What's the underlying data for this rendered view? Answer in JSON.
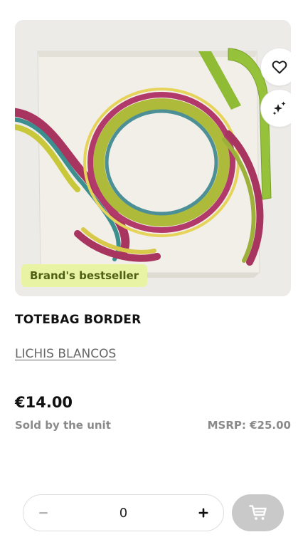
{
  "product": {
    "image_alt": "Totebag border product photo",
    "badge": "Brand's bestseller",
    "title": "TOTEBAG BORDER",
    "brand": "LICHIS BLANCOS",
    "price": "€14.00",
    "unit_text": "Sold by the unit",
    "msrp": "MSRP: €25.00"
  },
  "actions": {
    "favorite_icon": "heart-icon",
    "ai_icon": "sparkles-icon",
    "cart_icon": "shopping-cart-icon"
  },
  "quantity": {
    "value": "0",
    "minus_icon": "minus-icon",
    "plus_icon": "plus-icon"
  },
  "colors": {
    "badge_bg": "#e8f3a4",
    "badge_text": "#4f5f14",
    "cart_button_bg": "#c9c9c9",
    "strap_green": "#95c23a"
  }
}
